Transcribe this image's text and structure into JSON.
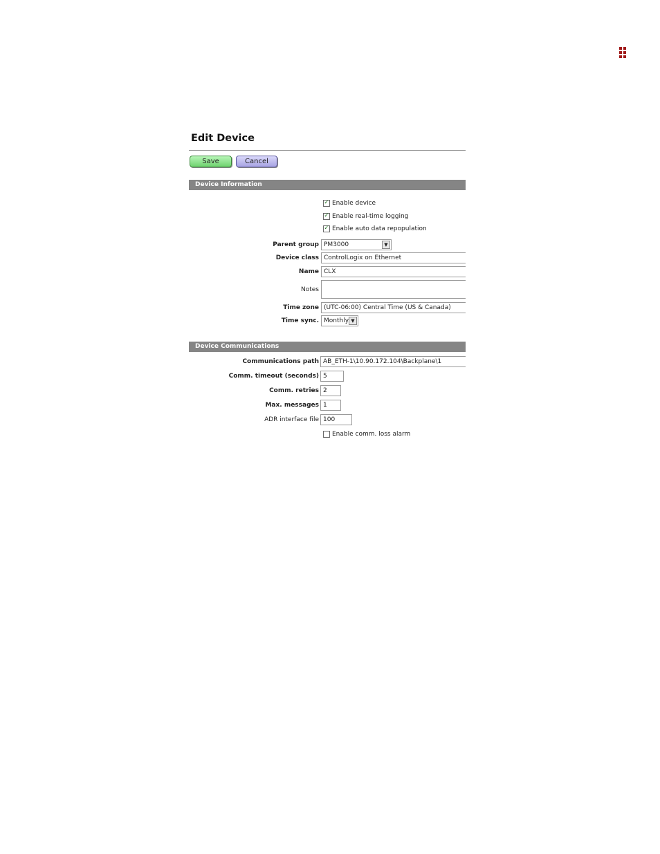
{
  "form": {
    "title": "Edit Device",
    "save_label": "Save",
    "cancel_label": "Cancel"
  },
  "device_info": {
    "heading": "Device Information",
    "enable_device": "Enable device",
    "enable_logging": "Enable real-time logging",
    "enable_adr": "Enable auto data repopulation",
    "parent_group_label": "Parent group",
    "parent_group_value": "PM3000",
    "device_class_label": "Device class",
    "device_class_value": "ControlLogix on Ethernet",
    "name_label": "Name",
    "name_value": "CLX",
    "notes_label": "Notes",
    "notes_value": "",
    "time_zone_label": "Time zone",
    "time_zone_value": "(UTC-06:00) Central Time (US & Canada)",
    "time_sync_label": "Time sync.",
    "time_sync_value": "Monthly"
  },
  "device_comm": {
    "heading": "Device Communications",
    "path_label": "Communications path",
    "path_value": "AB_ETH-1\\10.90.172.104\\Backplane\\1",
    "timeout_label": "Comm. timeout (seconds)",
    "timeout_value": "5",
    "retries_label": "Comm. retries",
    "retries_value": "2",
    "max_msg_label": "Max. messages",
    "max_msg_value": "1",
    "adr_label": "ADR interface file",
    "adr_value": "100",
    "loss_alarm_label": "Enable comm. loss alarm"
  },
  "checkbox_states": {
    "enable_device": true,
    "enable_logging": true,
    "enable_adr": true,
    "loss_alarm": false
  },
  "colors": {
    "section_bar": "#858585",
    "save_button": "#8fe38f",
    "cancel_button": "#bcb9ee",
    "logo": "#a01818"
  }
}
